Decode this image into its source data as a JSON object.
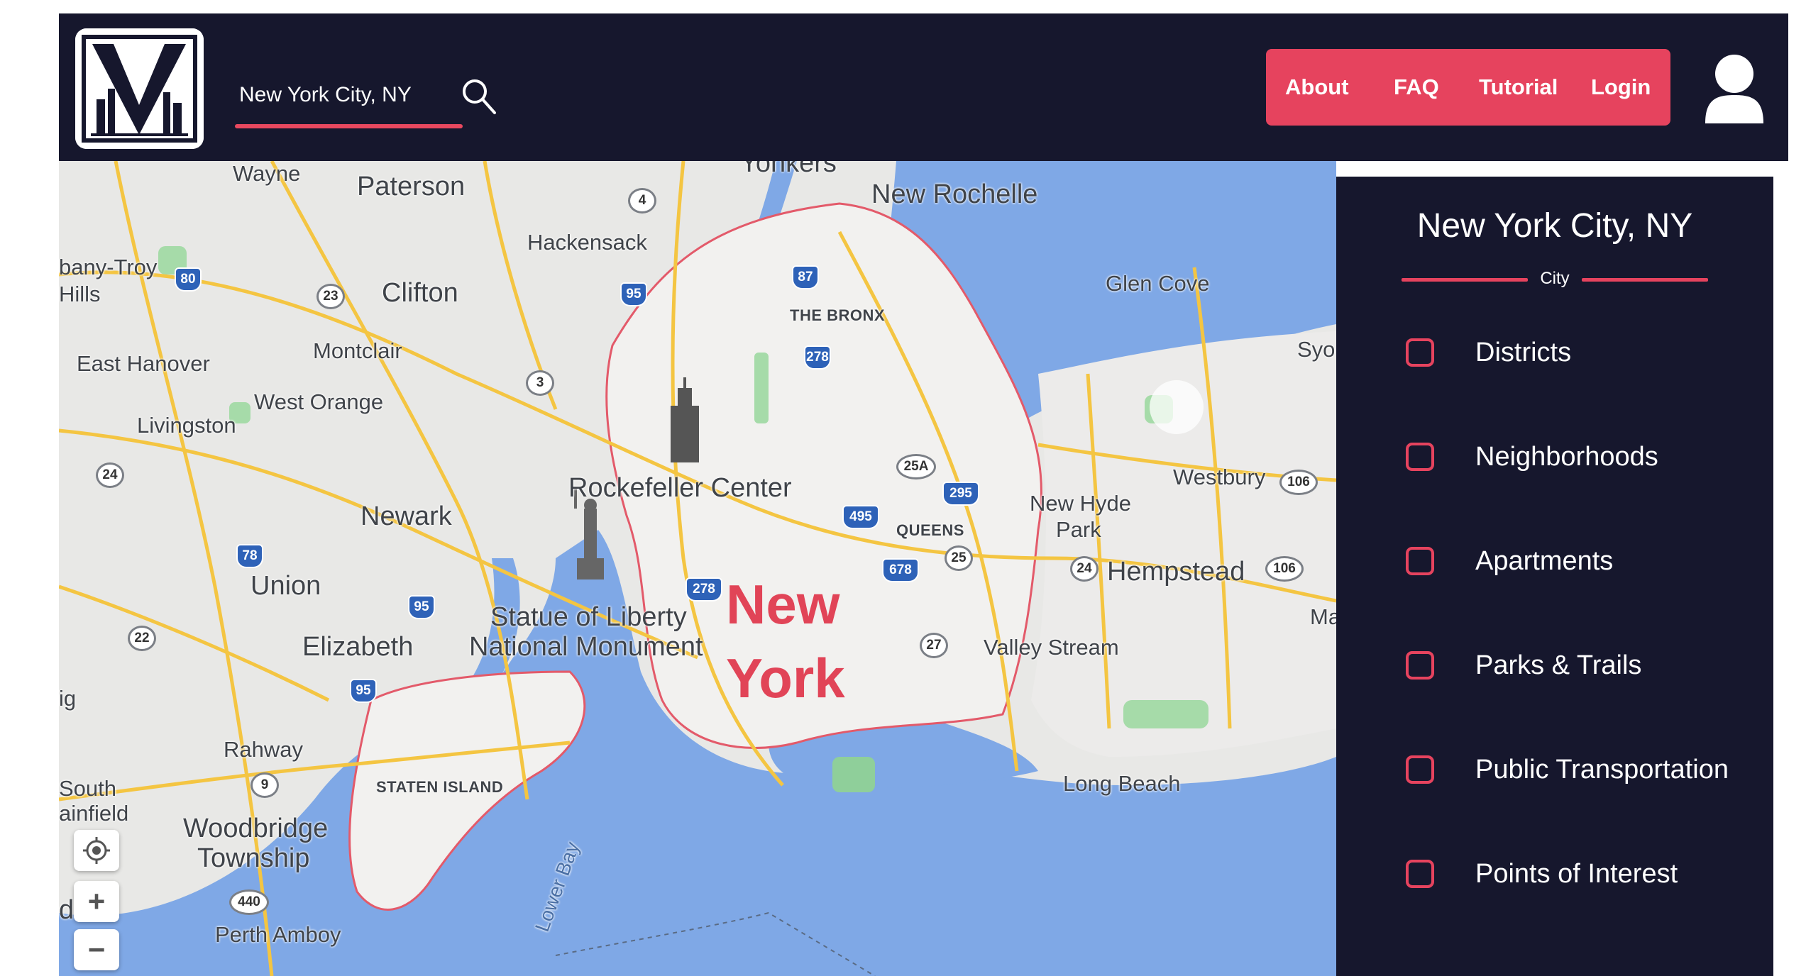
{
  "header": {
    "search_value": "New York City, NY",
    "nav": [
      "About",
      "FAQ",
      "Tutorial",
      "Login"
    ]
  },
  "map": {
    "city_label_line1": "New",
    "city_label_line2": "York",
    "labels": {
      "wayne": "Wayne",
      "paterson": "Paterson",
      "yonkers": "Yonkers",
      "new_rochelle": "New Rochelle",
      "hackensack": "Hackensack",
      "albany_troy": "bany-Troy",
      "hills": "Hills",
      "clifton": "Clifton",
      "glen_cove": "Glen Cove",
      "the_bronx": "THE BRONX",
      "east_hanover": "East Hanover",
      "montclair": "Montclair",
      "syo": "Syo",
      "west_orange": "West Orange",
      "livingston": "Livingston",
      "westbury": "Westbury",
      "rockefeller": "Rockefeller Center",
      "newark": "Newark",
      "new_hyde_park_1": "New Hyde",
      "new_hyde_park_2": "Park",
      "queens": "QUEENS",
      "hempstead": "Hempstead",
      "union": "Union",
      "statue_1": "Statue of Liberty",
      "statue_2": "National Monument",
      "elizabeth": "Elizabeth",
      "valley_stream": "Valley Stream",
      "ma": "Ma",
      "ig": "ig",
      "rahway": "Rahway",
      "staten_island": "STATEN ISLAND",
      "long_beach": "Long Beach",
      "south": "South",
      "plainfield": "ainfield",
      "woodbridge_1": "Woodbridge",
      "woodbridge_2": "Township",
      "lower_bay": "Lower Bay",
      "di": "di",
      "perth_amboy": "Perth Amboy"
    },
    "shields": {
      "s4": "4",
      "s80": "80",
      "s87": "87",
      "s95a": "95",
      "s23": "23",
      "s278a": "278",
      "s3": "3",
      "s25a": "25A",
      "s295": "295",
      "s495": "495",
      "s106a": "106",
      "s24a": "24",
      "s78": "78",
      "s678": "678",
      "s25": "25",
      "s278b": "278",
      "s24b": "24",
      "s106b": "106",
      "s95b": "95",
      "s22": "22",
      "s27": "27",
      "s95c": "95",
      "s9": "9",
      "s440": "440"
    },
    "controls": {
      "zoom_in": "+",
      "zoom_out": "−"
    }
  },
  "panel": {
    "title": "New York City, NY",
    "subtitle": "City",
    "layers": [
      "Districts",
      "Neighborhoods",
      "Apartments",
      "Parks & Trails",
      "Public Transportation",
      "Points of Interest"
    ]
  },
  "colors": {
    "header_bg": "#16172d",
    "accent": "#e6435e",
    "water": "#7fa8e6",
    "land": "#e9e9e9"
  }
}
